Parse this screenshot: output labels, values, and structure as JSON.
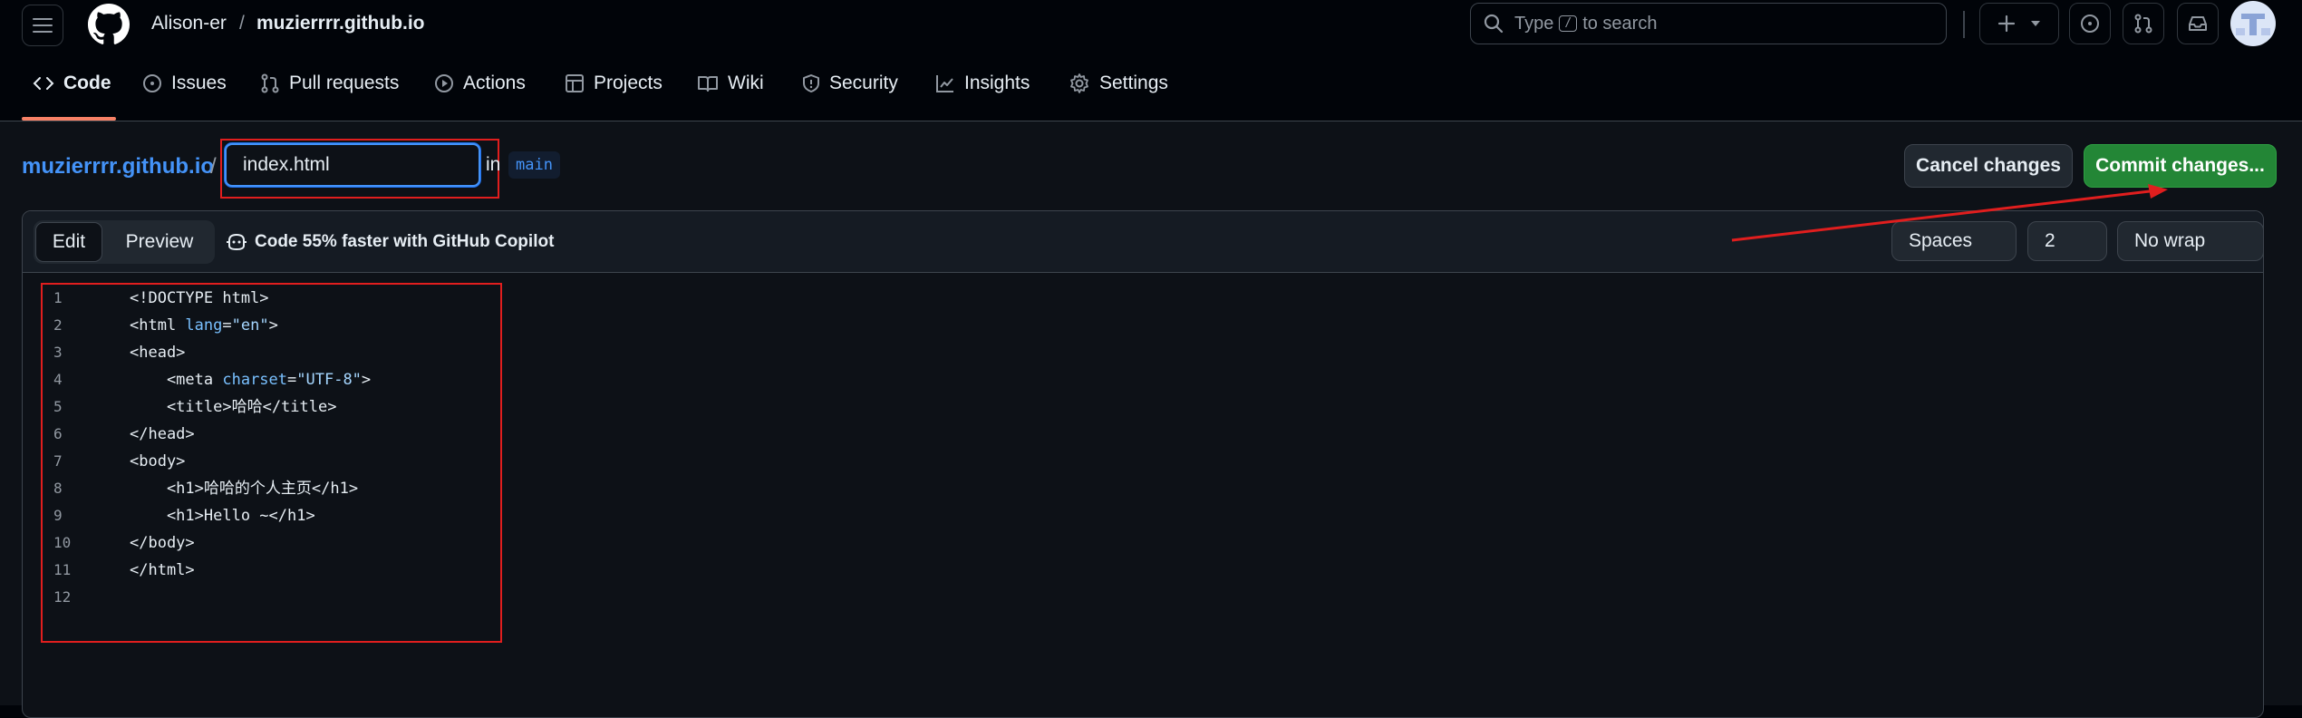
{
  "header": {
    "owner": "Alison-er",
    "separator": "/",
    "repo": "muzierrrr.github.io",
    "search": {
      "prefix": "Type",
      "key": "/",
      "suffix": "to search"
    }
  },
  "nav": {
    "tabs": [
      {
        "label": "Code",
        "icon": "code-icon",
        "active": true
      },
      {
        "label": "Issues",
        "icon": "issue-icon"
      },
      {
        "label": "Pull requests",
        "icon": "pull-request-icon"
      },
      {
        "label": "Actions",
        "icon": "play-icon"
      },
      {
        "label": "Projects",
        "icon": "table-icon"
      },
      {
        "label": "Wiki",
        "icon": "book-icon"
      },
      {
        "label": "Security",
        "icon": "shield-icon"
      },
      {
        "label": "Insights",
        "icon": "graph-icon"
      },
      {
        "label": "Settings",
        "icon": "gear-icon"
      }
    ]
  },
  "filebar": {
    "repo_link": "muzierrrr.github.io",
    "separator": "/",
    "filename_value": "index.html",
    "in_label": "in",
    "branch": "main",
    "cancel_label": "Cancel changes",
    "commit_label": "Commit changes..."
  },
  "editor": {
    "edit_tab": "Edit",
    "preview_tab": "Preview",
    "copilot_text": "Code 55% faster with GitHub Copilot",
    "indent_mode": "Spaces",
    "indent_size": "2",
    "wrap_mode": "No wrap",
    "lines": [
      {
        "n": "1",
        "text": "<!DOCTYPE html>"
      },
      {
        "n": "2",
        "text": "<html lang=\"en\">"
      },
      {
        "n": "3",
        "text": "<head>"
      },
      {
        "n": "4",
        "text": "    <meta charset=\"UTF-8\">"
      },
      {
        "n": "5",
        "text": "    <title>哈哈</title>"
      },
      {
        "n": "6",
        "text": "</head>"
      },
      {
        "n": "7",
        "text": "<body>"
      },
      {
        "n": "8",
        "text": "    <h1>哈哈的个人主页</h1>"
      },
      {
        "n": "9",
        "text": "    <h1>Hello ~</h1>"
      },
      {
        "n": "10",
        "text": "</body>"
      },
      {
        "n": "11",
        "text": "</html>"
      },
      {
        "n": "12",
        "text": ""
      }
    ]
  },
  "colors": {
    "accent_green": "#238636",
    "annotation_red": "#e01e1e",
    "link_blue": "#4493f8"
  }
}
